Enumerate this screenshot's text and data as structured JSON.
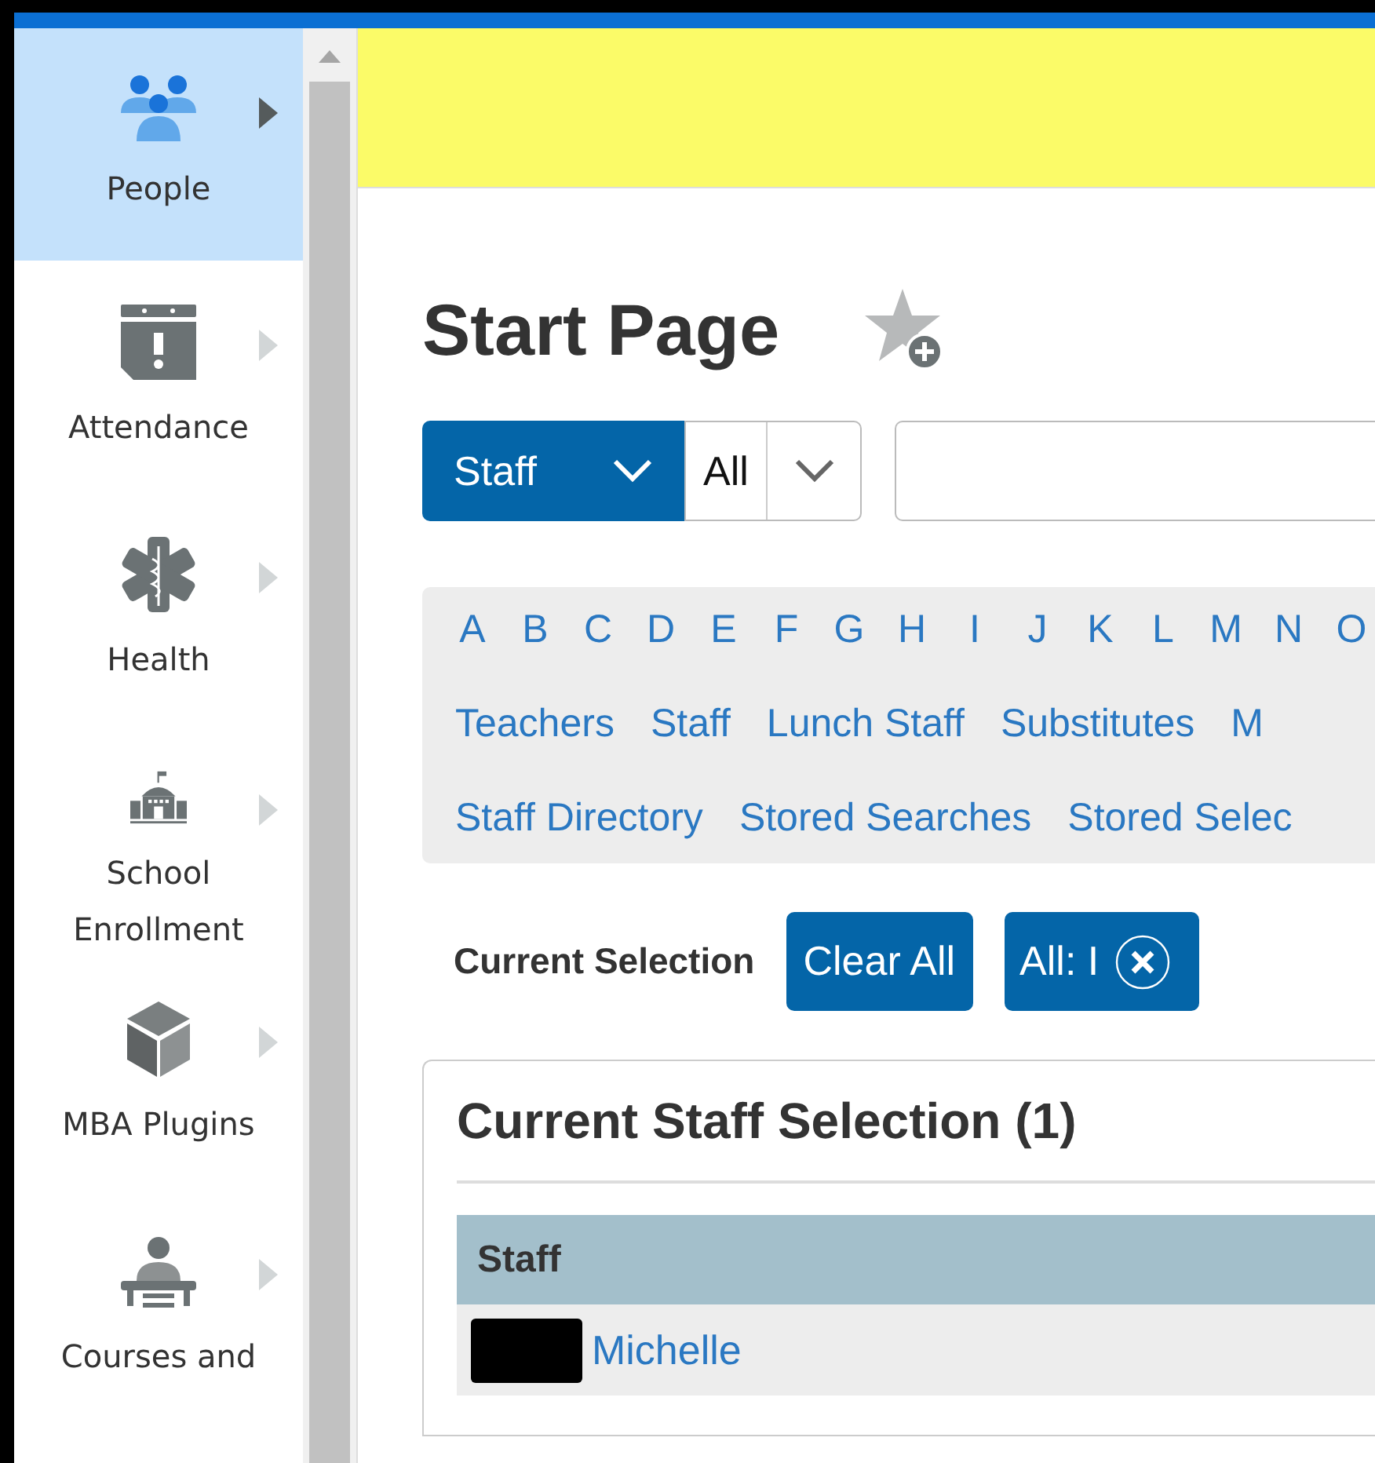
{
  "sidebar": {
    "items": [
      {
        "kind": "people",
        "label": "People",
        "selected": true
      },
      {
        "kind": "attendance",
        "label": "Attendance",
        "selected": false
      },
      {
        "kind": "health",
        "label": "Health",
        "selected": false
      },
      {
        "kind": "school",
        "label": "School Enrollment",
        "selected": false
      },
      {
        "kind": "plugins",
        "label": "MBA Plugins",
        "selected": false
      },
      {
        "kind": "courses",
        "label": "Courses and",
        "selected": false
      }
    ]
  },
  "page": {
    "title": "Start Page"
  },
  "search": {
    "type_select": "Staff",
    "scope_select": "All"
  },
  "letters": [
    "A",
    "B",
    "C",
    "D",
    "E",
    "F",
    "G",
    "H",
    "I",
    "J",
    "K",
    "L",
    "M",
    "N",
    "O"
  ],
  "groups": [
    "Teachers",
    "Staff",
    "Lunch Staff",
    "Substitutes",
    "M"
  ],
  "links": [
    "Staff Directory",
    "Stored Searches",
    "Stored Selec"
  ],
  "current_selection": {
    "label": "Current Selection",
    "clear_button": "Clear All",
    "chips": [
      "All: I"
    ]
  },
  "panel": {
    "title": "Current Staff Selection (1)",
    "columns": [
      "Staff"
    ],
    "rows": [
      {
        "name": "Michelle",
        "redacted": true
      }
    ]
  }
}
